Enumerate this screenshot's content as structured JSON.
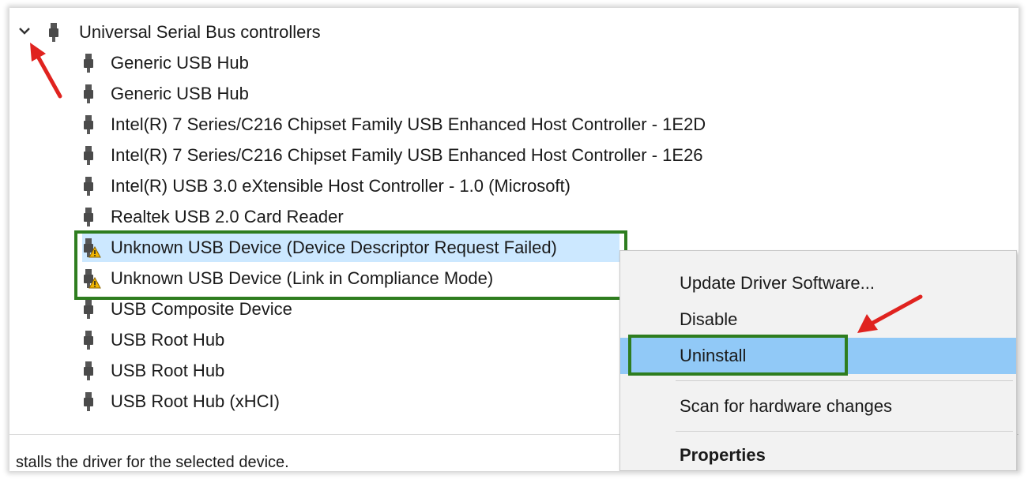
{
  "tree": {
    "category": {
      "label": "Universal Serial Bus controllers",
      "expanded": true,
      "icon": "usb-connector-icon",
      "expand_icon": "chevron-down-icon"
    },
    "devices": [
      {
        "label": "Generic USB Hub",
        "warning": false
      },
      {
        "label": "Generic USB Hub",
        "warning": false
      },
      {
        "label": "Intel(R) 7 Series/C216 Chipset Family USB Enhanced Host Controller - 1E2D",
        "warning": false
      },
      {
        "label": "Intel(R) 7 Series/C216 Chipset Family USB Enhanced Host Controller - 1E26",
        "warning": false
      },
      {
        "label": "Intel(R) USB 3.0 eXtensible Host Controller - 1.0 (Microsoft)",
        "warning": false
      },
      {
        "label": "Realtek USB 2.0 Card Reader",
        "warning": false
      },
      {
        "label": "Unknown USB Device (Device Descriptor Request Failed)",
        "warning": true,
        "selected": true
      },
      {
        "label": "Unknown USB Device (Link in Compliance Mode)",
        "warning": true
      },
      {
        "label": "USB Composite Device",
        "warning": false
      },
      {
        "label": "USB Root Hub",
        "warning": false
      },
      {
        "label": "USB Root Hub",
        "warning": false
      },
      {
        "label": "USB Root Hub (xHCI)",
        "warning": false
      }
    ]
  },
  "status_bar": {
    "text": "stalls the driver for the selected device."
  },
  "context_menu": {
    "items": [
      {
        "label": "Update Driver Software...",
        "selected": false,
        "bold": false
      },
      {
        "label": "Disable",
        "selected": false,
        "bold": false
      },
      {
        "label": "Uninstall",
        "selected": true,
        "bold": false
      },
      {
        "label": "Scan for hardware changes",
        "selected": false,
        "bold": false
      },
      {
        "label": "Properties",
        "selected": false,
        "bold": true
      }
    ]
  },
  "annotations": {
    "highlight_color": "#2e7d1f",
    "arrow_color": "#e0231f",
    "selection_color": "#cce8ff",
    "menu_selection_color": "#91c9f7",
    "warning_color": "#f0b400"
  }
}
